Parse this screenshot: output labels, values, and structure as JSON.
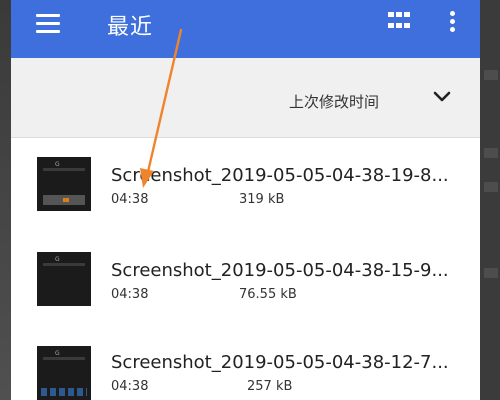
{
  "appbar": {
    "title": "最近",
    "menu_icon": "hamburger-menu-icon",
    "grid_icon": "grid-view-icon",
    "more_icon": "more-vert-icon",
    "color": "#3f6fdc"
  },
  "sortbar": {
    "label": "上次修改时间",
    "chevron": "chevron-down-icon"
  },
  "files": [
    {
      "name": "Screenshot_2019-05-05-04-38-19-8...",
      "time": "04:38",
      "size": "319 kB"
    },
    {
      "name": "Screenshot_2019-05-05-04-38-15-9...",
      "time": "04:38",
      "size": "76.55 kB"
    },
    {
      "name": "Screenshot_2019-05-05-04-38-12-7...",
      "time": "04:38",
      "size": "257 kB"
    }
  ],
  "annotation": {
    "arrow_color": "#f0842a"
  }
}
